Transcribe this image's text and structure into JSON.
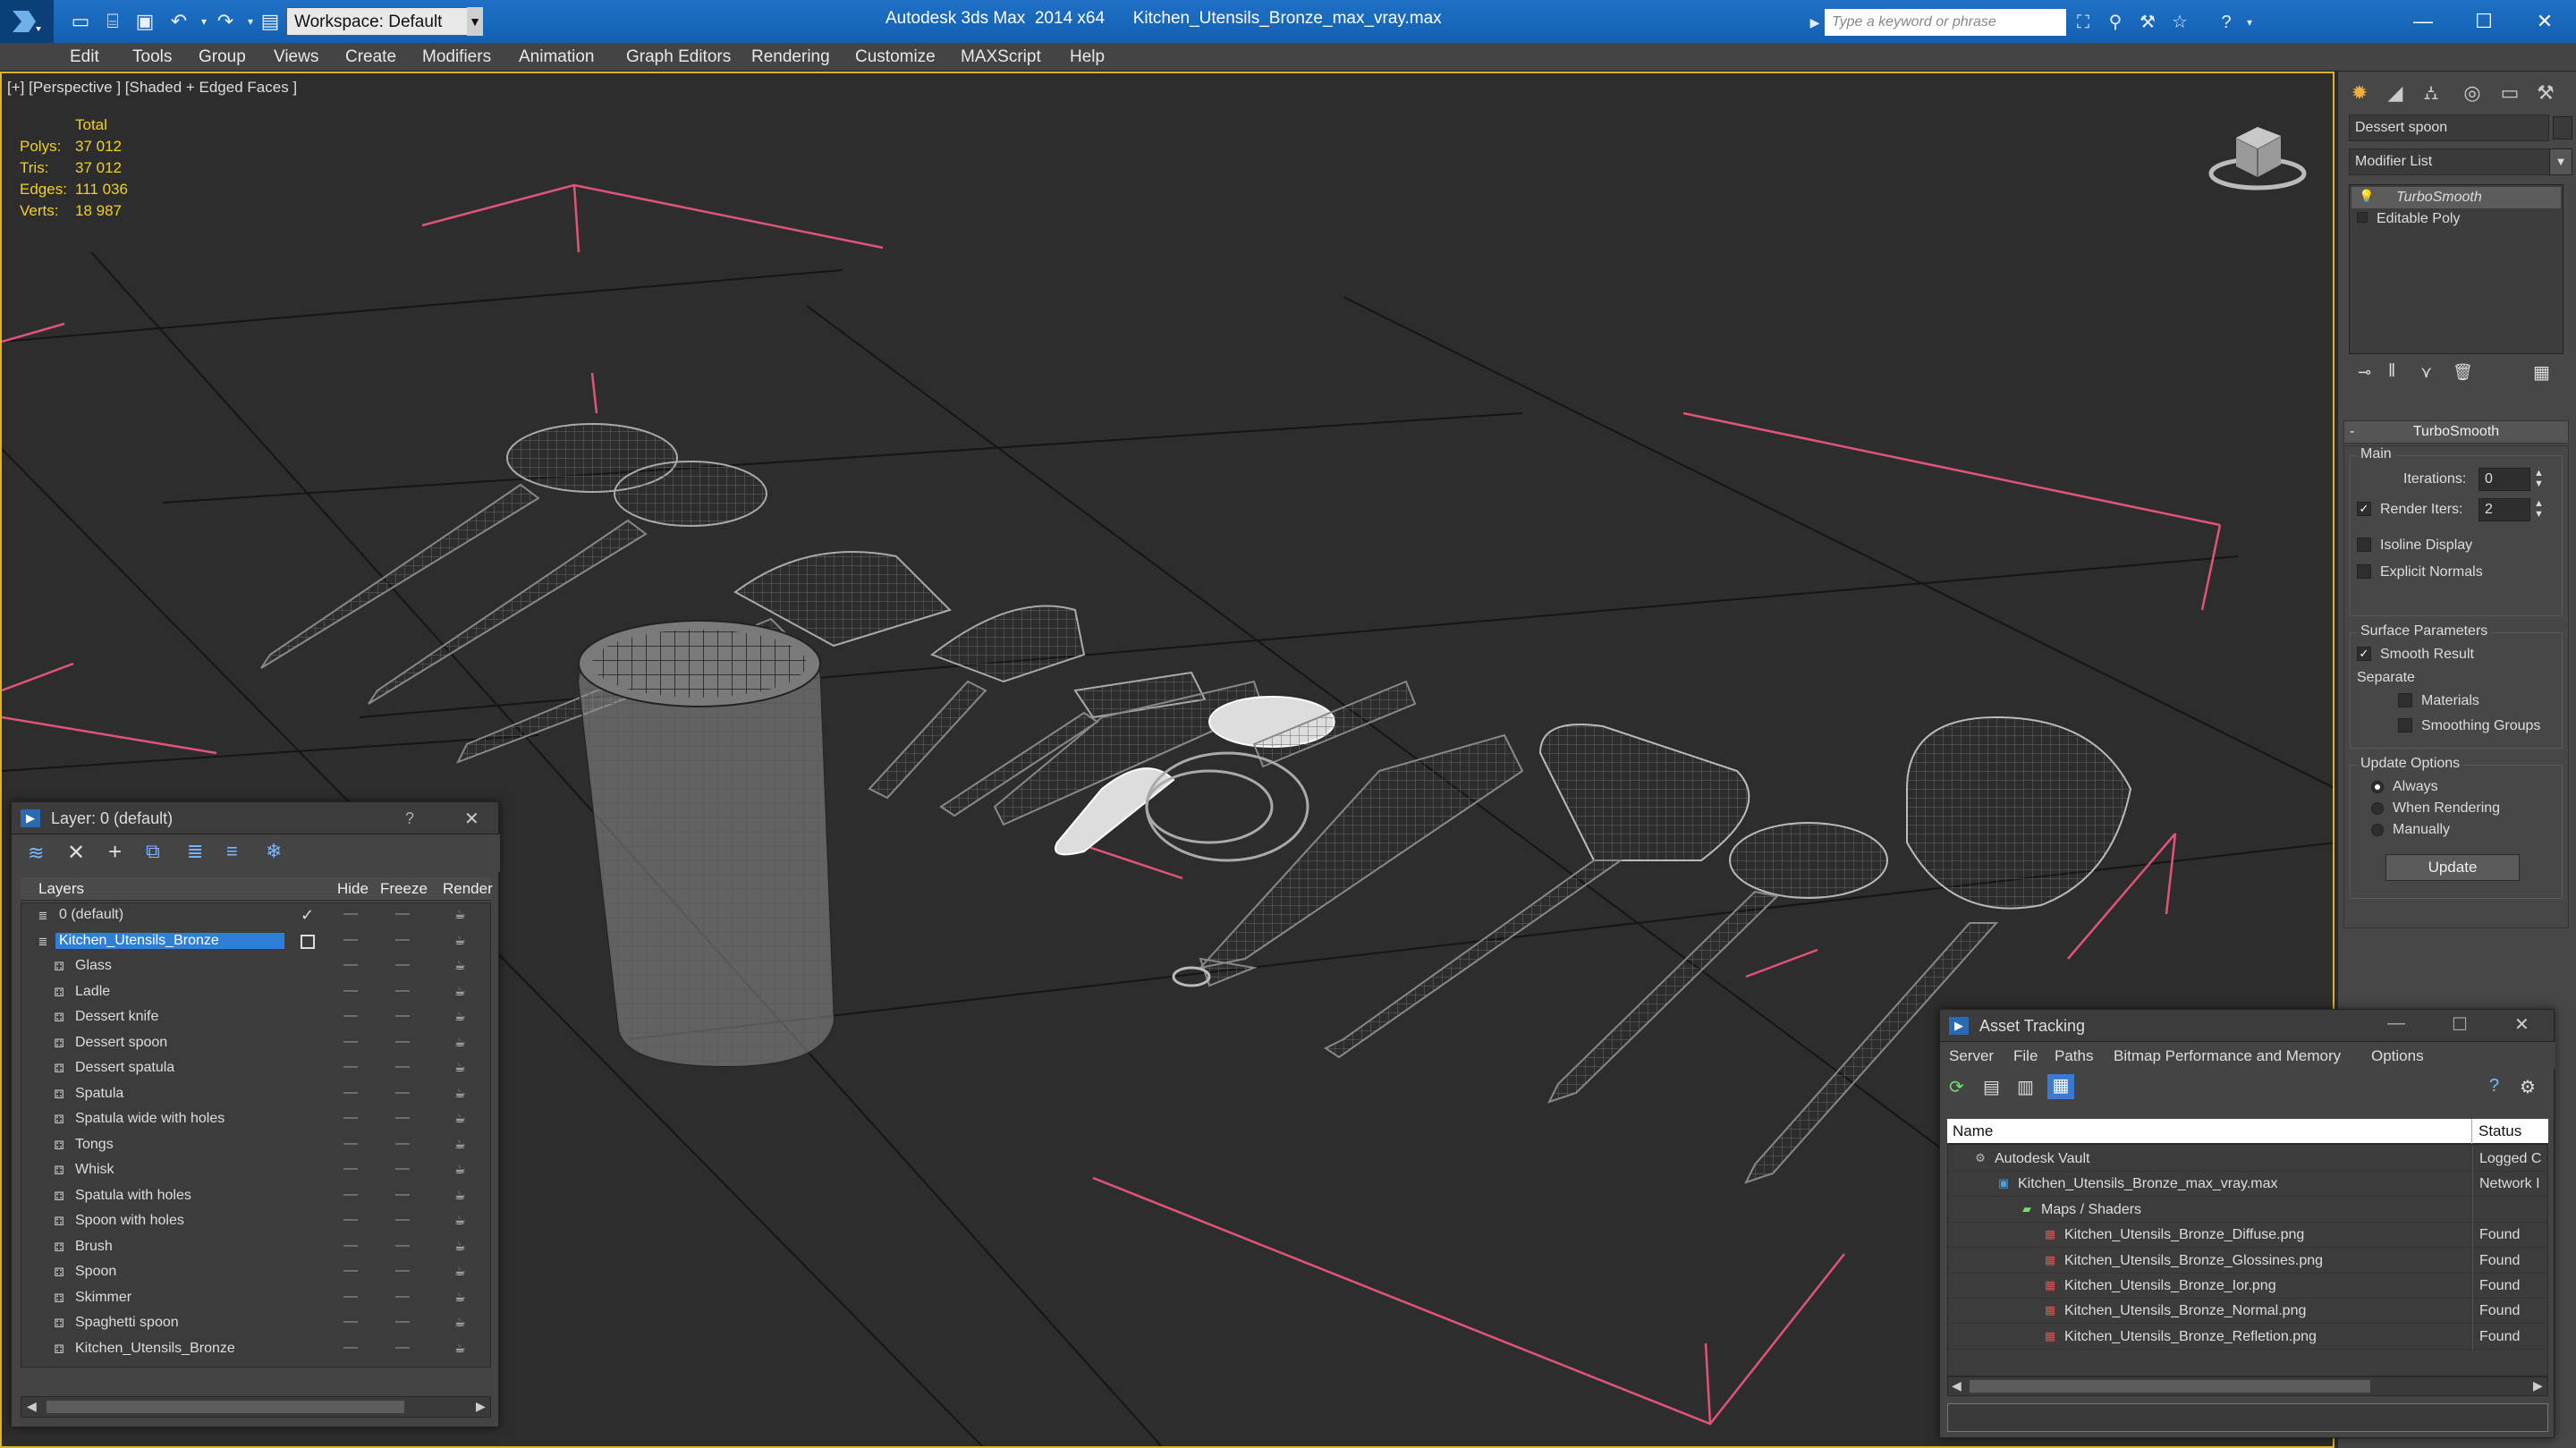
{
  "titlebar": {
    "app_title": "Autodesk 3ds Max  2014 x64      Kitchen_Utensils_Bronze_max_vray.max",
    "workspace": "Workspace: Default",
    "search_placeholder": "Type a keyword or phrase"
  },
  "menubar": {
    "items": [
      "Edit",
      "Tools",
      "Group",
      "Views",
      "Create",
      "Modifiers",
      "Animation",
      "Graph Editors",
      "Rendering",
      "Customize",
      "MAXScript",
      "Help"
    ]
  },
  "viewport": {
    "label": "[+] [Perspective ] [Shaded + Edged Faces ]",
    "stats": {
      "header": "Total",
      "rows": [
        {
          "label": "Polys:",
          "value": "37 012"
        },
        {
          "label": "Tris:",
          "value": "37 012"
        },
        {
          "label": "Edges:",
          "value": "111 036"
        },
        {
          "label": "Verts:",
          "value": "18 987"
        }
      ]
    }
  },
  "command_panel": {
    "object_name": "Dessert spoon",
    "modifier_list": "Modifier List",
    "stack": [
      "TurboSmooth",
      "Editable Poly"
    ],
    "turbosmooth": {
      "title": "TurboSmooth",
      "main": "Main",
      "iterations_label": "Iterations:",
      "iterations_value": "0",
      "render_iters_label": "Render Iters:",
      "render_iters_value": "2",
      "isoline": "Isoline Display",
      "explicit_normals": "Explicit Normals",
      "surface_params": "Surface Parameters",
      "smooth_result": "Smooth Result",
      "separate": "Separate",
      "materials": "Materials",
      "smoothing_groups": "Smoothing Groups",
      "update_options": "Update Options",
      "always": "Always",
      "when_rendering": "When Rendering",
      "manually": "Manually",
      "update_button": "Update"
    }
  },
  "layer_dialog": {
    "title": "Layer: 0 (default)",
    "help": "?",
    "close": "✕",
    "columns": [
      "Layers",
      "Hide",
      "Freeze",
      "Render"
    ],
    "layers": [
      {
        "name": "0 (default)",
        "level": 0
      },
      {
        "name": "Kitchen_Utensils_Bronze",
        "level": 0,
        "selected": true
      },
      {
        "name": "Glass",
        "level": 1
      },
      {
        "name": "Ladle",
        "level": 1
      },
      {
        "name": "Dessert knife",
        "level": 1
      },
      {
        "name": "Dessert spoon",
        "level": 1
      },
      {
        "name": "Dessert spatula",
        "level": 1
      },
      {
        "name": "Spatula",
        "level": 1
      },
      {
        "name": "Spatula wide with holes",
        "level": 1
      },
      {
        "name": "Tongs",
        "level": 1
      },
      {
        "name": "Whisk",
        "level": 1
      },
      {
        "name": "Spatula with holes",
        "level": 1
      },
      {
        "name": "Spoon with holes",
        "level": 1
      },
      {
        "name": "Brush",
        "level": 1
      },
      {
        "name": "Spoon",
        "level": 1
      },
      {
        "name": "Skimmer",
        "level": 1
      },
      {
        "name": "Spaghetti spoon",
        "level": 1
      },
      {
        "name": "Kitchen_Utensils_Bronze",
        "level": 1
      }
    ]
  },
  "asset_dialog": {
    "title": "Asset Tracking",
    "menu": [
      "Server",
      "File",
      "Paths",
      "Bitmap Performance and Memory",
      "Options"
    ],
    "columns": [
      "Name",
      "Status"
    ],
    "rows": [
      {
        "name": "Autodesk Vault",
        "status": "Logged C",
        "level": 0
      },
      {
        "name": "Kitchen_Utensils_Bronze_max_vray.max",
        "status": "Network I",
        "level": 1
      },
      {
        "name": "Maps / Shaders",
        "status": "",
        "level": 2
      },
      {
        "name": "Kitchen_Utensils_Bronze_Diffuse.png",
        "status": "Found",
        "level": 3
      },
      {
        "name": "Kitchen_Utensils_Bronze_Glossines.png",
        "status": "Found",
        "level": 3
      },
      {
        "name": "Kitchen_Utensils_Bronze_Ior.png",
        "status": "Found",
        "level": 3
      },
      {
        "name": "Kitchen_Utensils_Bronze_Normal.png",
        "status": "Found",
        "level": 3
      },
      {
        "name": "Kitchen_Utensils_Bronze_Refletion.png",
        "status": "Found",
        "level": 3
      }
    ]
  }
}
